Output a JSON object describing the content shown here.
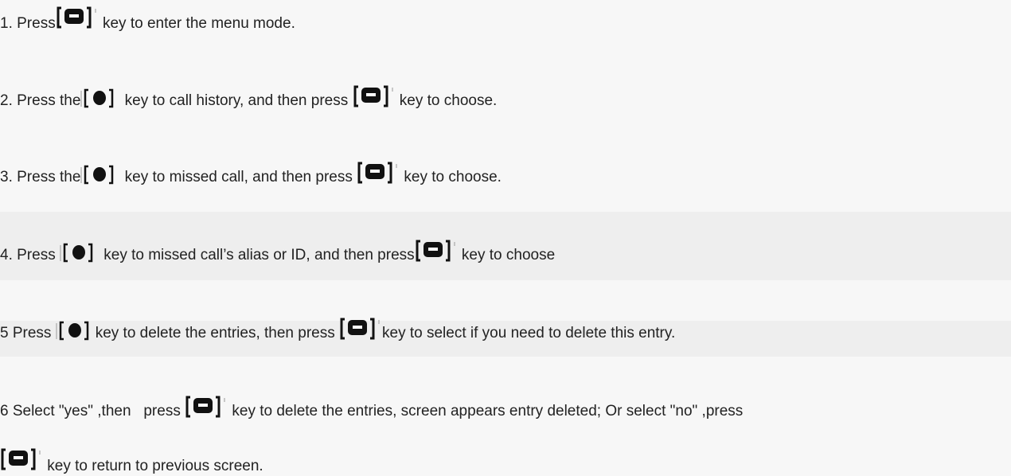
{
  "instructions": [
    {
      "text": [
        "1. Press",
        " key to enter the menu mode."
      ],
      "keys": [
        "menu-key-icon"
      ]
    },
    {
      "text": [
        "2. Press the",
        " key to call history, and then press ",
        " key to choose."
      ],
      "keys": [
        "nav-key-icon",
        "menu-key-icon"
      ]
    },
    {
      "text": [
        "3. Press the",
        " key to missed call, and then press ",
        " key to choose."
      ],
      "keys": [
        "nav-key-icon",
        "menu-key-icon"
      ]
    },
    {
      "text": [
        "4. Press ",
        " key to missed call’s alias or ID, and then press",
        " key to choose"
      ],
      "keys": [
        "nav-key-icon",
        "menu-key-icon"
      ]
    },
    {
      "text": [
        "5 Press ",
        "key to delete the entries, then press ",
        "key to select if you need to delete this entry."
      ],
      "keys": [
        "nav-key-icon",
        "menu-key-icon"
      ]
    },
    {
      "text": [
        "6 Select \"yes\" ,then   press ",
        " key to delete the entries, screen appears entry deleted; Or select \"no\" ,press"
      ],
      "keys": [
        "menu-key-icon"
      ]
    },
    {
      "text": [
        "",
        " key to return to previous screen."
      ],
      "keys": [
        "menu-key-icon"
      ]
    }
  ],
  "colors": {
    "background": "#f7f7f7",
    "band": "#eeeeee",
    "text": "#222222",
    "key": "#111111"
  }
}
